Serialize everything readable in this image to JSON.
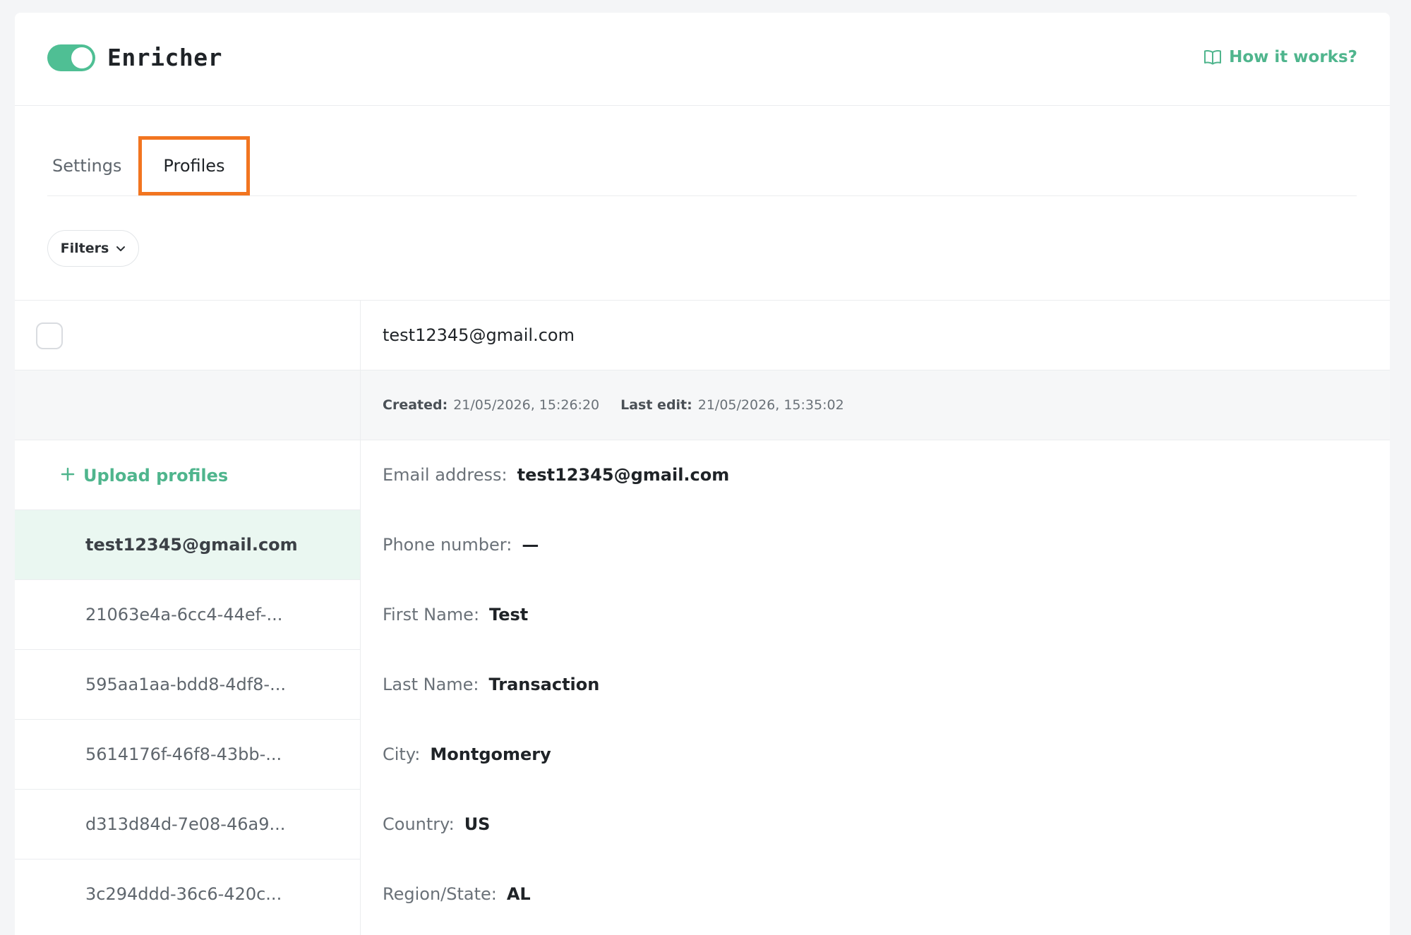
{
  "header": {
    "title": "Enricher",
    "toggle_on": true,
    "help_link": "How it works?",
    "accent_color": "#4fbf94",
    "help_icon": "book-icon"
  },
  "tabs": [
    {
      "label": "Settings",
      "active": false
    },
    {
      "label": "Profiles",
      "active": true,
      "highlight_color": "#f27520"
    }
  ],
  "filters": {
    "label": "Filters",
    "icon": "chevron-down-icon"
  },
  "profile_header": {
    "email": "test12345@gmail.com"
  },
  "meta": {
    "created_label": "Created:",
    "created_value": "21/05/2026, 15:26:20",
    "last_edit_label": "Last edit:",
    "last_edit_value": "21/05/2026, 15:35:02"
  },
  "sidebar": {
    "upload_label": "Upload profiles",
    "upload_icon": "plus-icon",
    "items": [
      {
        "label": "test12345@gmail.com",
        "active": true
      },
      {
        "label": "21063e4a-6cc4-44ef-..."
      },
      {
        "label": "595aa1aa-bdd8-4df8-..."
      },
      {
        "label": "5614176f-46f8-43bb-..."
      },
      {
        "label": "d313d84d-7e08-46a9..."
      },
      {
        "label": "3c294ddd-36c6-420c..."
      }
    ]
  },
  "details": [
    {
      "label": "Email address:",
      "value": "test12345@gmail.com"
    },
    {
      "label": "Phone number:",
      "value": "—"
    },
    {
      "label": "First Name:",
      "value": "Test"
    },
    {
      "label": "Last Name:",
      "value": "Transaction"
    },
    {
      "label": "City:",
      "value": "Montgomery"
    },
    {
      "label": "Country:",
      "value": "US"
    },
    {
      "label": "Region/State:",
      "value": "AL"
    }
  ]
}
